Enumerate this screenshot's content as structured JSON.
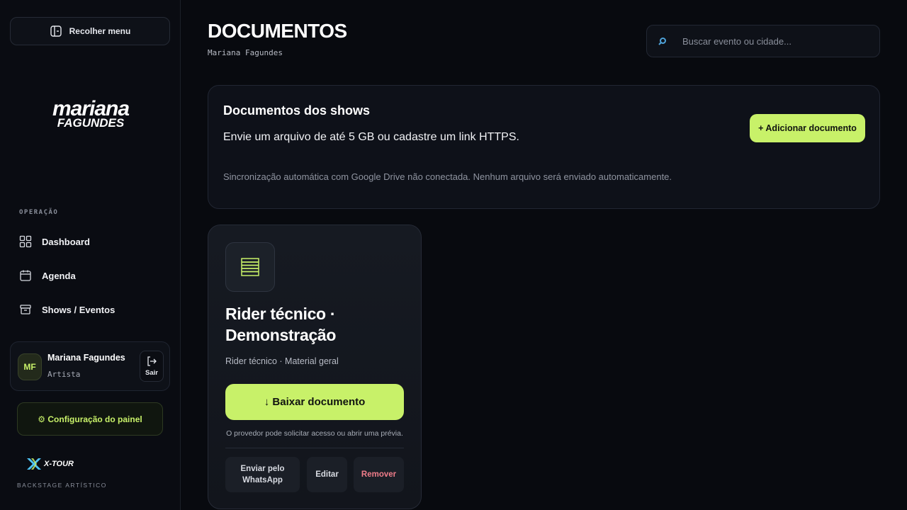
{
  "sidebar": {
    "collapse_label": "Recolher menu",
    "logo_line1": "mariana",
    "logo_line2": "FAGUNDES",
    "section_label": "OPERAÇÃO",
    "items": [
      {
        "label": "Dashboard",
        "icon": "grid-icon"
      },
      {
        "label": "Agenda",
        "icon": "calendar-icon"
      },
      {
        "label": "Shows / Eventos",
        "icon": "archive-icon"
      }
    ],
    "user": {
      "initials": "MF",
      "name": "Mariana Fagundes",
      "role": "Artista",
      "logout_label": "Sair"
    },
    "config_label": "⚙ Configuração do painel",
    "brand_name": "X-TOUR",
    "brand_sub": "BACKSTAGE ARTÍSTICO"
  },
  "header": {
    "title": "DOCUMENTOS",
    "subtitle": "Mariana Fagundes",
    "search_placeholder": "Buscar evento ou cidade..."
  },
  "panel": {
    "title": "Documentos dos shows",
    "description": "Envie um arquivo de até 5 GB ou cadastre um link HTTPS.",
    "note": "Sincronização automática com Google Drive não conectada. Nenhum arquivo será enviado automaticamente.",
    "add_label": "+ Adicionar documento"
  },
  "documents": [
    {
      "title": "Rider técnico · Demonstração",
      "meta": "Rider técnico · Material geral",
      "download_label": "↓ Baixar documento",
      "hint": "O provedor pode solicitar acesso ou abrir uma prévia.",
      "actions": {
        "whatsapp": "Enviar pelo WhatsApp",
        "edit": "Editar",
        "remove": "Remover"
      }
    }
  ],
  "colors": {
    "accent": "#c8f169",
    "danger": "#f07d8a",
    "background": "#080a0f"
  }
}
